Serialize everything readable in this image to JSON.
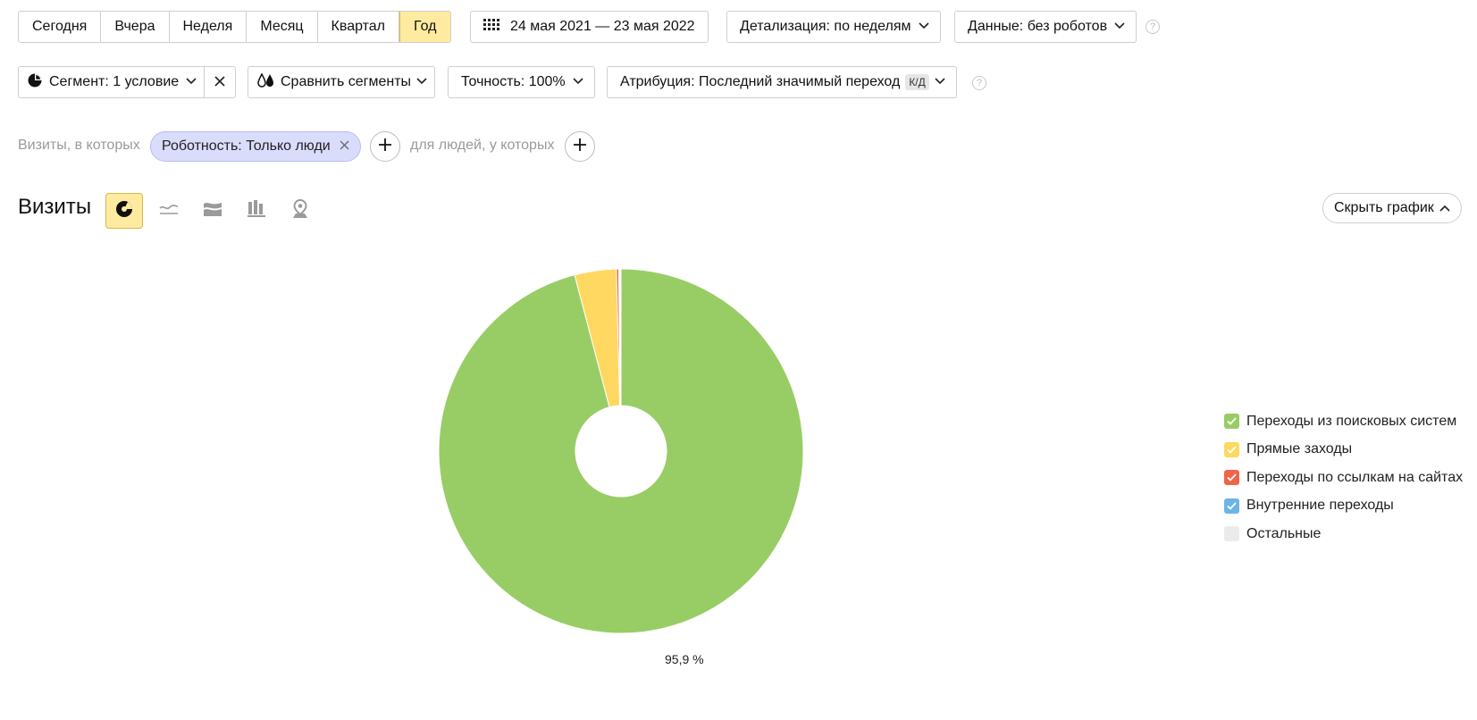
{
  "periods": [
    "Сегодня",
    "Вчера",
    "Неделя",
    "Месяц",
    "Квартал",
    "Год"
  ],
  "active_period": "Год",
  "date_range": "24 мая 2021 — 23 мая 2022",
  "detail": "Детализация: по неделям",
  "data_filter": "Данные: без роботов",
  "segment": "Сегмент: 1 условие",
  "compare": "Сравнить сегменты",
  "accuracy": "Точность: 100%",
  "attribution": "Атрибуция: Последний значимый переход",
  "attribution_badge": "К/Д",
  "filters": {
    "visits_label": "Визиты, в которых",
    "chip": "Роботность: Только люди",
    "people_label": "для людей, у которых"
  },
  "chart_header": {
    "title": "Визиты",
    "hide": "Скрыть график"
  },
  "colors": {
    "accent": "#ffeba0",
    "chip": "#dadcfb",
    "search": "#98cd65",
    "direct": "#ffd861",
    "links": "#f06548",
    "internal": "#6db4e8",
    "other": "#ebebeb"
  },
  "chart_data": {
    "type": "pie",
    "title": "",
    "donut": true,
    "series": [
      {
        "name": "Переходы из поисковых систем",
        "value": 95.9,
        "color": "#98cd65"
      },
      {
        "name": "Прямые заходы",
        "value": 3.7,
        "color": "#ffd861"
      },
      {
        "name": "Переходы по ссылкам на сайтах",
        "value": 0.2,
        "color": "#f06548"
      },
      {
        "name": "Внутренние переходы",
        "value": 0.1,
        "color": "#6db4e8"
      },
      {
        "name": "Остальные",
        "value": 0.1,
        "color": "#ebebeb"
      }
    ],
    "data_labels": [
      "95,9 %"
    ]
  }
}
